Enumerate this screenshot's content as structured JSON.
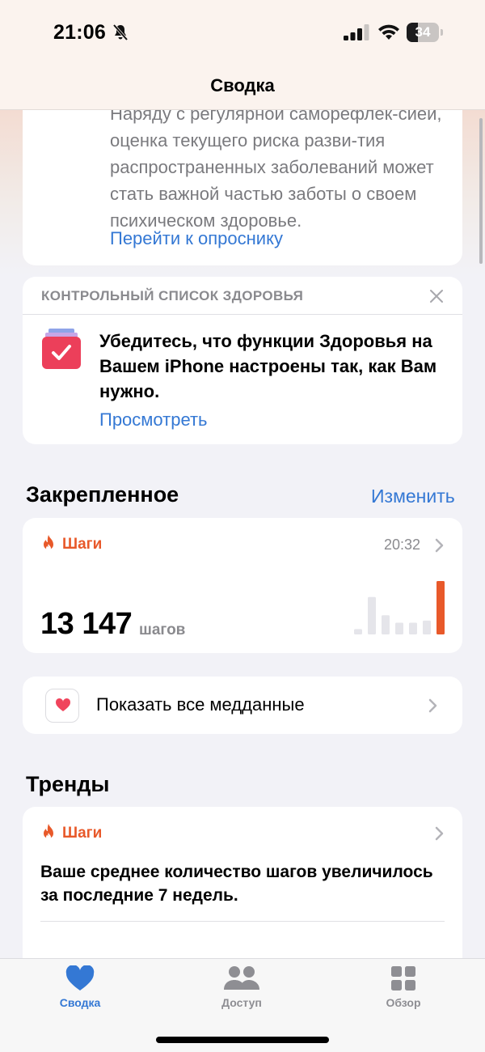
{
  "status_bar": {
    "time": "21:06",
    "battery": "34",
    "battery_level": 0.34
  },
  "navbar": {
    "title": "Сводка"
  },
  "mental_card": {
    "text": "Наряду с регулярной саморефлек-сией, оценка текущего риска разви-тия распространенных заболеваний может стать важной частью заботы о своем психическом здоровье.",
    "link": "Перейти к опроснику"
  },
  "checklist_card": {
    "heading": "КОНТРОЛЬНЫЙ СПИСОК ЗДОРОВЬЯ",
    "text": "Убедитесь, что функции Здоровья на Вашем iPhone настроены так, как Вам нужно.",
    "link": "Просмотреть"
  },
  "pinned": {
    "title": "Закрепленное",
    "edit": "Изменить",
    "steps": {
      "label": "Шаги",
      "time": "20:32",
      "value": "13 147",
      "unit": "шагов",
      "bars": [
        0.1,
        0.7,
        0.36,
        0.22,
        0.22,
        0.26,
        1.0
      ],
      "accent": "#e8592a",
      "bar_color": "#e5e5ea"
    },
    "records": {
      "label": "Показать все медданные"
    }
  },
  "trends": {
    "title": "Тренды",
    "card": {
      "label": "Шаги",
      "text": "Ваше среднее количество шагов увеличилось за последние 7 недель."
    }
  },
  "tabbar": {
    "items": [
      {
        "label": "Сводка",
        "icon": "heart-icon",
        "active": true
      },
      {
        "label": "Доступ",
        "icon": "people-icon",
        "active": false
      },
      {
        "label": "Обзор",
        "icon": "grid-icon",
        "active": false
      }
    ]
  },
  "colors": {
    "link": "#3478d4",
    "accent": "#e8592a",
    "secondary_text": "#8a8a8e"
  }
}
